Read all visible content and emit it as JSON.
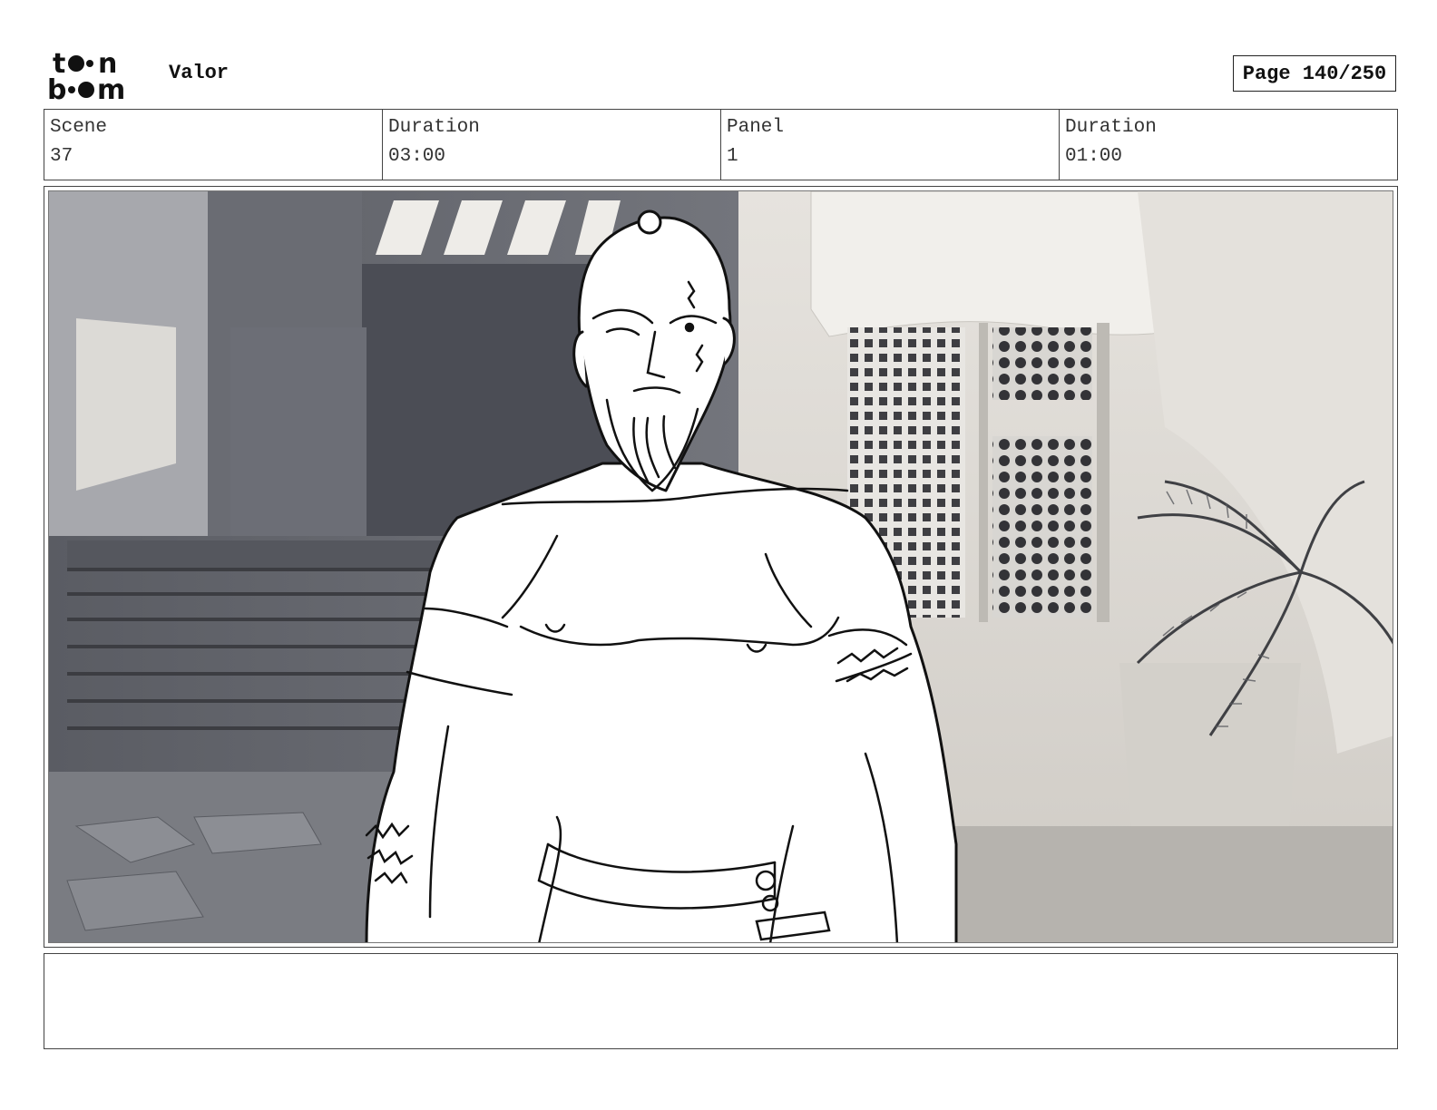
{
  "header": {
    "logo_name": "toonboom-logo",
    "logo_text": "toonboom",
    "project_title": "Valor",
    "page_label": "Page",
    "page_value": "140/250"
  },
  "info": {
    "scene_label": "Scene",
    "scene_value": "37",
    "scene_duration_label": "Duration",
    "scene_duration_value": "03:00",
    "panel_label": "Panel",
    "panel_value": "1",
    "panel_duration_label": "Duration",
    "panel_duration_value": "01:00"
  },
  "panel": {
    "description": "",
    "colors": {
      "shadow": "#5e6068",
      "wall": "#d9d5cf",
      "line": "#111111"
    }
  },
  "notes": {
    "text": ""
  }
}
